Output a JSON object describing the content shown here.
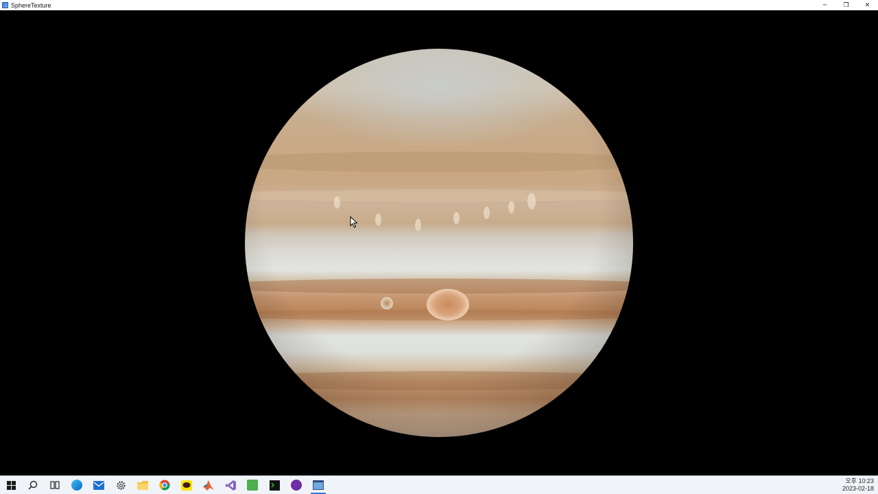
{
  "window": {
    "title": "SphereTexture",
    "controls": {
      "minimize": "─",
      "restore": "❐",
      "close": "✕"
    }
  },
  "taskbar": {
    "items": [
      {
        "name": "start",
        "icon": "windows-start-icon"
      },
      {
        "name": "search",
        "icon": "search-icon"
      },
      {
        "name": "task-view",
        "icon": "task-view-icon"
      },
      {
        "name": "edge",
        "icon": "edge-browser-icon"
      },
      {
        "name": "mail",
        "icon": "mail-icon"
      },
      {
        "name": "settings",
        "icon": "gear-icon"
      },
      {
        "name": "file-explorer",
        "icon": "folder-icon"
      },
      {
        "name": "chrome",
        "icon": "chrome-icon"
      },
      {
        "name": "kakaotalk",
        "icon": "chat-bubble-icon"
      },
      {
        "name": "matlab",
        "icon": "matlab-icon"
      },
      {
        "name": "visual-studio",
        "icon": "visual-studio-icon"
      },
      {
        "name": "app-green",
        "icon": "green-app-icon"
      },
      {
        "name": "terminal",
        "icon": "terminal-icon"
      },
      {
        "name": "app-purple",
        "icon": "purple-circle-icon"
      },
      {
        "name": "sphere-texture",
        "icon": "window-app-icon"
      }
    ],
    "clock": {
      "time": "오후 10:23",
      "date": "2023-02-18"
    }
  },
  "colors": {
    "background": "#000000",
    "taskbar": "#f0f3f7",
    "active_indicator": "#3b78d8"
  }
}
